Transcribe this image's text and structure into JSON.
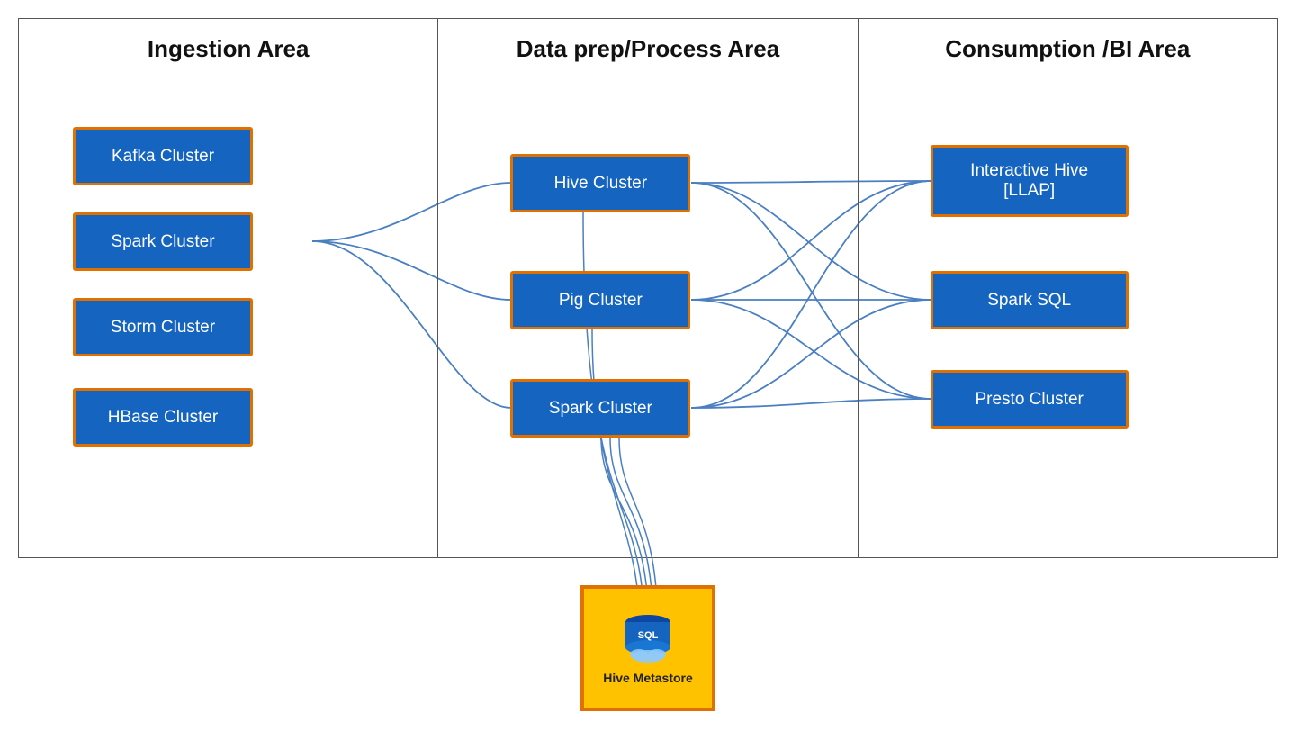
{
  "areas": [
    {
      "id": "ingestion",
      "title": "Ingestion Area",
      "clusters": [
        {
          "id": "kafka",
          "label": "Kafka Cluster"
        },
        {
          "id": "spark1",
          "label": "Spark Cluster"
        },
        {
          "id": "storm",
          "label": "Storm Cluster"
        },
        {
          "id": "hbase",
          "label": "HBase Cluster"
        }
      ]
    },
    {
      "id": "dataprep",
      "title": "Data prep/Process Area",
      "clusters": [
        {
          "id": "hive",
          "label": "Hive Cluster"
        },
        {
          "id": "pig",
          "label": "Pig Cluster"
        },
        {
          "id": "spark2",
          "label": "Spark Cluster"
        }
      ]
    },
    {
      "id": "consumption",
      "title": "Consumption /BI Area",
      "clusters": [
        {
          "id": "ihive",
          "label": "Interactive Hive [LLAP]"
        },
        {
          "id": "sparksql",
          "label": "Spark SQL"
        },
        {
          "id": "presto",
          "label": "Presto Cluster"
        }
      ]
    }
  ],
  "metastore": {
    "label": "Hive Metastore",
    "sql_label": "SQL"
  }
}
